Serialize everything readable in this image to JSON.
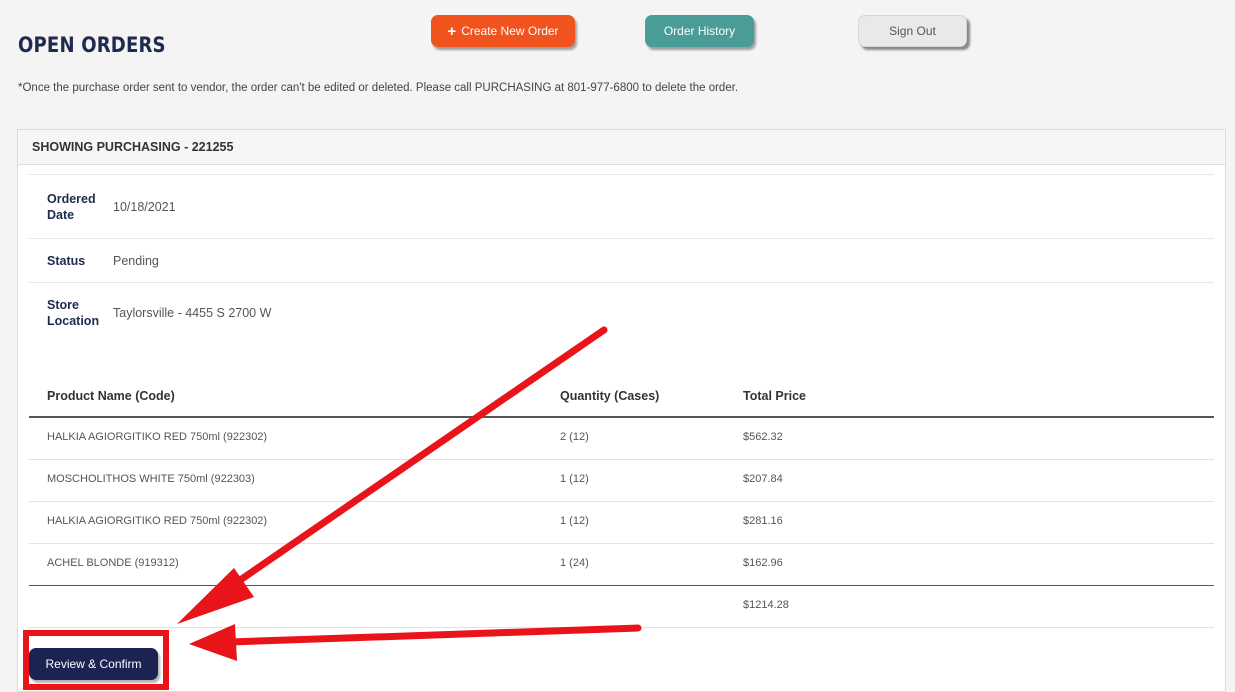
{
  "header": {
    "title": "OPEN ORDERS",
    "create_label": "Create New Order",
    "create_icon": "plus-icon",
    "history_label": "Order History",
    "signout_label": "Sign Out"
  },
  "notice": "*Once the purchase order sent to vendor, the order can't be edited or deleted. Please call PURCHASING at 801-977-6800 to delete the order.",
  "panel": {
    "heading": "SHOWING PURCHASING - 221255"
  },
  "details": [
    {
      "label": "Ordered Date",
      "value": "10/18/2021"
    },
    {
      "label": "Status",
      "value": "Pending"
    },
    {
      "label": "Store Location",
      "value": "Taylorsville - 4455 S 2700 W"
    }
  ],
  "table": {
    "columns": [
      "Product Name (Code)",
      "Quantity (Cases)",
      "Total Price"
    ],
    "rows": [
      {
        "product": "HALKIA AGIORGITIKO RED 750ml (922302)",
        "quantity": "2 (12)",
        "price": "$562.32"
      },
      {
        "product": "MOSCHOLITHOS WHITE 750ml (922303)",
        "quantity": "1 (12)",
        "price": "$207.84"
      },
      {
        "product": "HALKIA AGIORGITIKO RED 750ml (922302)",
        "quantity": "1 (12)",
        "price": "$281.16"
      },
      {
        "product": "ACHEL BLONDE (919312)",
        "quantity": "1 (24)",
        "price": "$162.96"
      }
    ],
    "total": "$1214.28"
  },
  "review_button_label": "Review & Confirm",
  "colors": {
    "brand_navy": "#1a2352",
    "create_orange": "#f1531f",
    "history_teal": "#4a9c96",
    "annotation_red": "#e8141a"
  }
}
